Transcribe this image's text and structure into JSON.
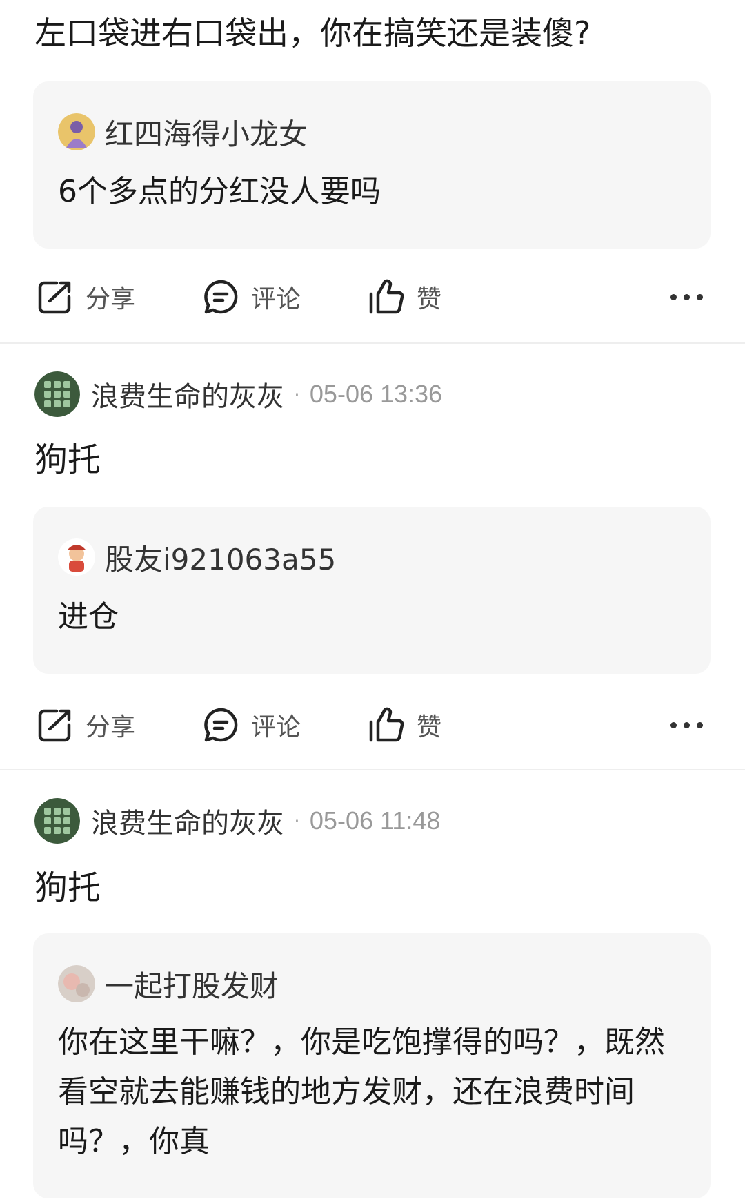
{
  "top_post": {
    "text": "左口袋进右口袋出，你在搞笑还是装傻?",
    "quote": {
      "author": "红四海得小龙女",
      "text": "6个多点的分红没人要吗"
    }
  },
  "actions": {
    "share": "分享",
    "comment": "评论",
    "like": "赞"
  },
  "comments": [
    {
      "author": "浪费生命的灰灰",
      "separator": "·",
      "time": "05-06 13:36",
      "text": "狗托",
      "quote": {
        "author": "股友i921063a55",
        "text": "进仓"
      }
    },
    {
      "author": "浪费生命的灰灰",
      "separator": "·",
      "time": "05-06 11:48",
      "text": "狗托",
      "quote": {
        "author": "一起打股发财",
        "text": "你在这里干嘛？，你是吃饱撑得的吗？，既然看空就去能赚钱的地方发财，还在浪费时间吗？，你真"
      }
    }
  ]
}
